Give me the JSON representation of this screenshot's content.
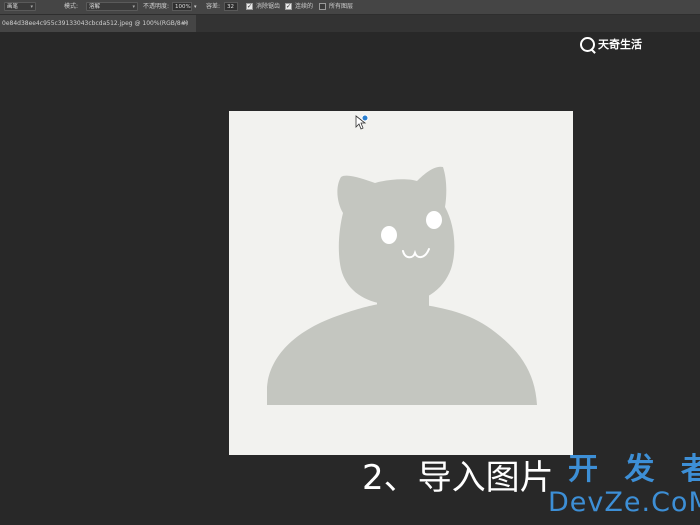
{
  "options_bar": {
    "tool_preset_label": "画笔",
    "mode_label": "模式:",
    "mode_value": "溶解",
    "opacity_label": "不透明度:",
    "opacity_value": "100%",
    "tolerance_label": "容差:",
    "tolerance_value": "32",
    "anti_alias_label": "消除锯齿",
    "anti_alias_checked": true,
    "contiguous_label": "连续的",
    "contiguous_checked": true,
    "all_layers_label": "所有图层",
    "all_layers_checked": false
  },
  "document_tab": {
    "title": "0e84d38ee4c955c39133043cbcda512.jpeg @ 100%(RGB/8#)",
    "close_label": "×"
  },
  "canvas": {
    "background_color": "#f2f2ef",
    "figure_color": "#c4c6c0"
  },
  "watermark_logo": {
    "text": "天奇生活"
  },
  "caption": {
    "text": "2、导入图片"
  },
  "site_watermark": {
    "chinese": "开 发 者",
    "english": "DevZe.CoM"
  }
}
